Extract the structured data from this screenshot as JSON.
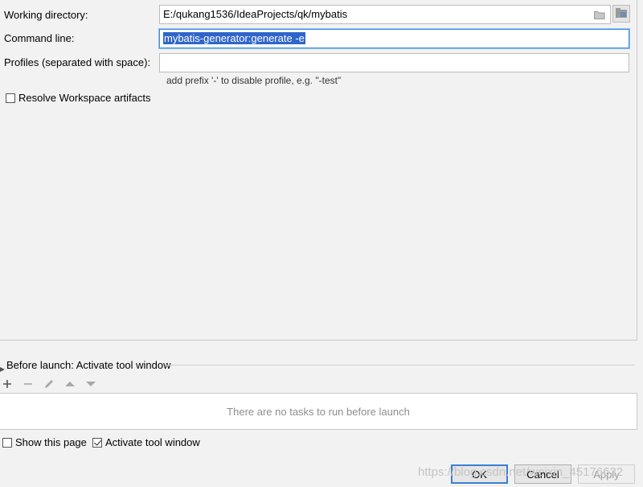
{
  "form": {
    "working_directory_label": "Working directory:",
    "working_directory_value": "E:/qukang1536/IdeaProjects/qk/mybatis",
    "command_line_label": "Command line:",
    "command_line_value": "mybatis-generator:generate -e",
    "profiles_label": "Profiles (separated with space):",
    "profiles_value": "",
    "profiles_hint": "add prefix '-' to disable profile, e.g. \"-test\"",
    "resolve_workspace_label": "Resolve Workspace artifacts",
    "resolve_workspace_checked": false
  },
  "before_launch": {
    "title": "Before launch: Activate tool window",
    "toolbar_icons": [
      "add-icon",
      "remove-icon",
      "edit-icon",
      "move-up-icon",
      "move-down-icon"
    ],
    "empty_text": "There are no tasks to run before launch"
  },
  "options": {
    "show_page_label": "Show this page",
    "show_page_checked": false,
    "activate_tool_window_label": "Activate tool window",
    "activate_tool_window_checked": true
  },
  "buttons": {
    "ok": "OK",
    "cancel": "Cancel",
    "apply": "Apply"
  },
  "watermark": "https://blog.csdn.net/weixin_45176622",
  "colors": {
    "selection": "#2f65ca",
    "focus_border": "#3d8fd6",
    "background": "#f2f2f2"
  }
}
